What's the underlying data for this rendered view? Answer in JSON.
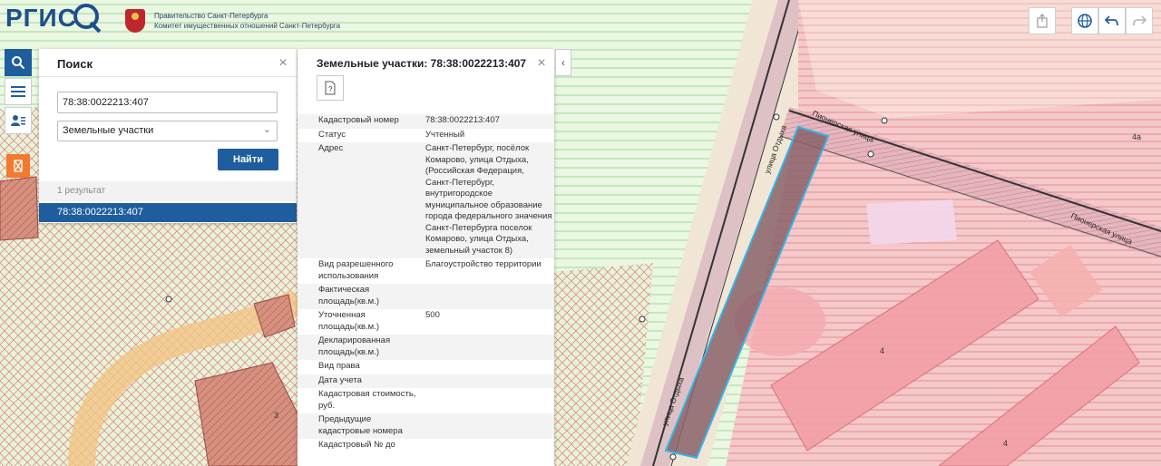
{
  "header": {
    "logo_text": "РГИС",
    "org_line1": "Правительство Санкт-Петербурга",
    "org_line2": "Комитет имущественных отношений Санкт-Петербурга"
  },
  "toolbar": {
    "icons": [
      "search-icon",
      "menu-icon",
      "user-list-icon",
      "city-layer-icon"
    ]
  },
  "search": {
    "title": "Поиск",
    "query": "78:38:0022213:407",
    "type_selected": "Земельные участки",
    "button": "Найти",
    "results_count": "1 результат",
    "results": [
      "78:38:0022213:407"
    ]
  },
  "details": {
    "title": "Земельные участки: 78:38:0022213:407",
    "doc_icon": "?",
    "rows": [
      {
        "k": "Кадастровый номер",
        "v": "78:38:0022213:407"
      },
      {
        "k": "Статус",
        "v": "Учтенный"
      },
      {
        "k": "Адрес",
        "v": "Санкт-Петербург, посёлок Комарово, улица Отдыха, (Российская Федерация, Санкт-Петербург, внутригородское муниципальное образование города федерального значения Санкт-Петербурга поселок Комарово, улица Отдыха, земельный участок 8)"
      },
      {
        "k": "Вид разрешенного использования",
        "v": "Благоустройство территории"
      },
      {
        "k": "Фактическая площадь(кв.м.)",
        "v": ""
      },
      {
        "k": "Уточненная площадь(кв.м.)",
        "v": "500"
      },
      {
        "k": "Декларированная площадь(кв.м.)",
        "v": ""
      },
      {
        "k": "Вид права",
        "v": ""
      },
      {
        "k": "Дата учета",
        "v": ""
      },
      {
        "k": "Кадастровая стоимость, руб.",
        "v": ""
      },
      {
        "k": "Предыдущие кадастровые номера",
        "v": ""
      },
      {
        "k": "Кадастровый № до",
        "v": ""
      }
    ]
  },
  "map": {
    "street_labels": [
      "Пионерская улица",
      "Пионерская улица",
      "улица Отдыха",
      "улица Отдыха"
    ],
    "parcel_labels": [
      "4а",
      "4",
      "4",
      "3"
    ]
  },
  "controls": {
    "icons": [
      "share-icon",
      "globe-icon",
      "undo-icon",
      "redo-icon"
    ]
  },
  "colors": {
    "accent": "#1e5e9e",
    "zone_green": "#8fdc8a",
    "zone_red": "#e8667a",
    "highlight": "#33b5e5"
  }
}
